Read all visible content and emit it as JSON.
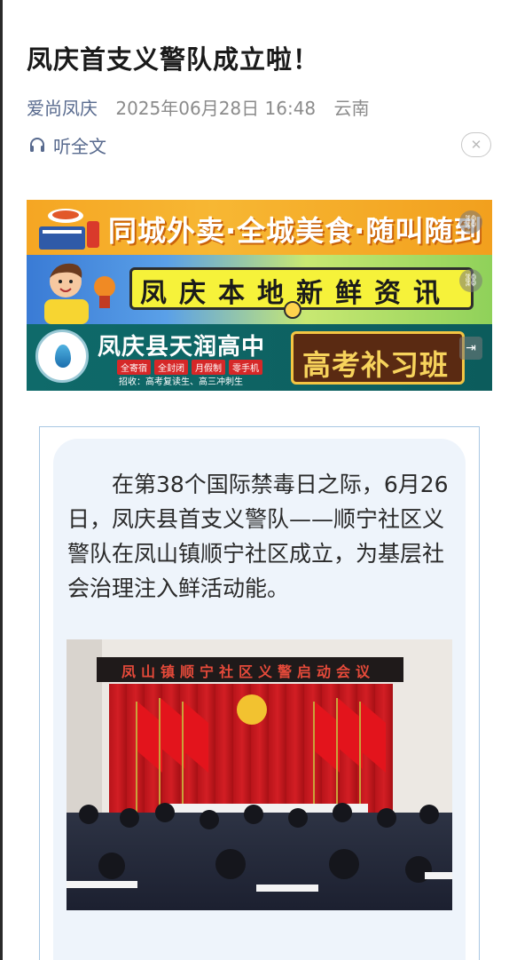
{
  "article": {
    "title": "凤庆首支义警队成立啦！",
    "account": "爱尚凤庆",
    "datetime": "2025年06月28日 16:48",
    "location": "云南",
    "listen_label": "听全文"
  },
  "banners": {
    "delivery_text": "同城外卖·全城美食·随叫随到",
    "news_text": "凤庆本地新鲜资讯",
    "school_name": "凤庆县天润高中",
    "school_tags": [
      "全寄宿",
      "全封闭",
      "月假制",
      "零手机"
    ],
    "school_recruit": "招收：高考复读生、高三冲刺生",
    "school_badge": "高考补习班"
  },
  "body": {
    "paragraph": "在第38个国际禁毒日之际，6月26日，凤庆县首支义警队——顺宁社区义警队在凤山镇顺宁社区成立，为基层社会治理注入鲜活动能。",
    "photo_banner": "凤山镇顺宁社区义警启动会议"
  },
  "icons": {
    "headphones": "headphones-icon",
    "close": "close-icon",
    "link": "link-icon",
    "exit": "exit-icon"
  },
  "colors": {
    "account_link": "#586a8e",
    "meta_gray": "#8b8b8b",
    "card_bg": "#eef4fb",
    "frame_border": "#a9c7e3"
  }
}
